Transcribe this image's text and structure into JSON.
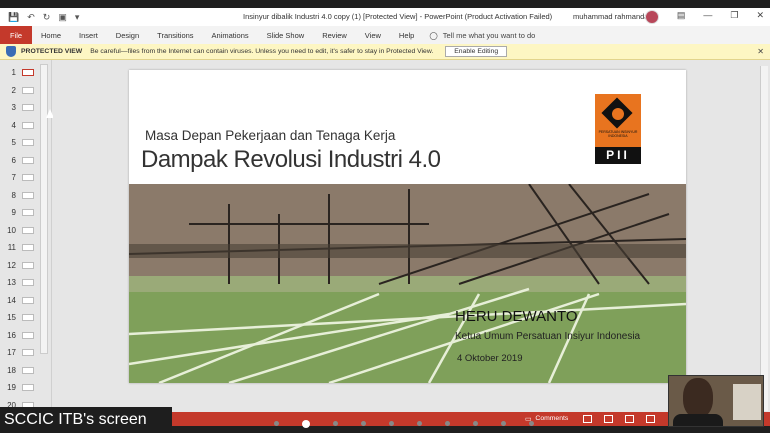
{
  "window": {
    "title": "Insinyur dibalik Industri 4.0 copy (1) [Protected View]  -  PowerPoint (Product Activation Failed)",
    "user_name": "muhammad rahmanda"
  },
  "ribbon": {
    "file_label": "File",
    "tabs": [
      "Home",
      "Insert",
      "Design",
      "Transitions",
      "Animations",
      "Slide Show",
      "Review",
      "View",
      "Help"
    ],
    "tell_me": "Tell me what you want to do"
  },
  "protected_view": {
    "title": "PROTECTED VIEW",
    "message": "Be careful—files from the Internet can contain viruses. Unless you need to edit, it's safer to stay in Protected View.",
    "button": "Enable Editing"
  },
  "thumbnails": [
    "1",
    "2",
    "3",
    "4",
    "5",
    "6",
    "7",
    "8",
    "9",
    "10",
    "11",
    "12",
    "13",
    "14",
    "15",
    "16",
    "17",
    "18",
    "19",
    "20"
  ],
  "slide": {
    "subtitle": "Masa Depan Pekerjaan dan Tenaga Kerja",
    "title": "Dampak Revolusi Industri 4.0",
    "logo_text_small": "PERSATUAN INSINYUR INDONESIA",
    "logo_text": "PII",
    "presenter_name": "HERU DEWANTO",
    "presenter_role": "Ketua Umum Persatuan Insiyur Indonesia",
    "date": "4 Oktober 2019"
  },
  "status_bar": {
    "comments_label": "Comments"
  },
  "overlay": {
    "screen_share_label": "SCCIC ITB's screen"
  },
  "colors": {
    "accent": "#c4392b",
    "protected_bg": "#fdf6c3",
    "logo_orange": "#e8741f"
  }
}
